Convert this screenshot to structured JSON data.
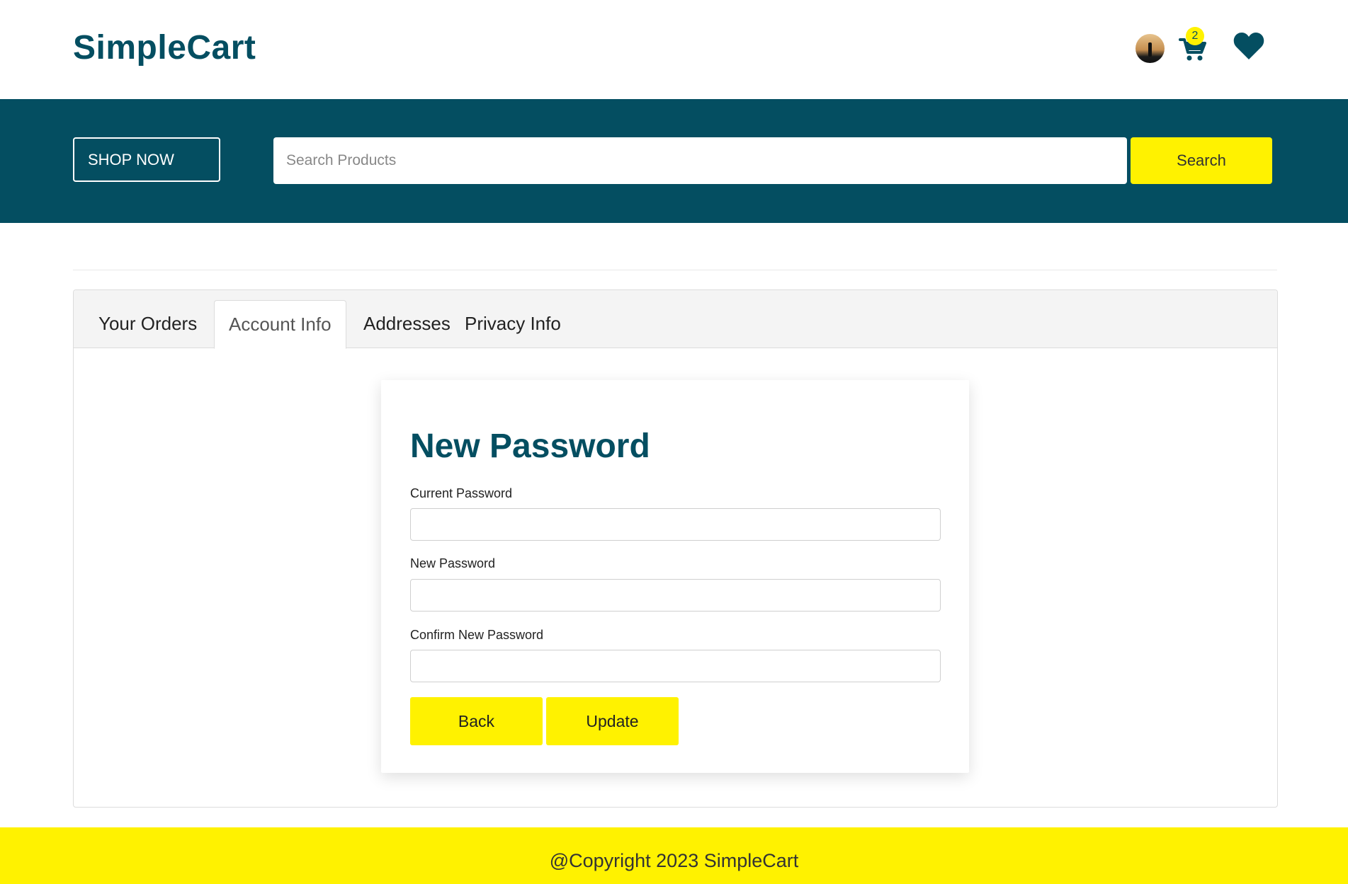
{
  "header": {
    "logo": "SimpleCart",
    "cart_count": "2"
  },
  "nav": {
    "shop_now_label": "SHOP NOW",
    "search_placeholder": "Search Products",
    "search_button_label": "Search"
  },
  "tabs": [
    {
      "label": "Your Orders",
      "active": false
    },
    {
      "label": "Account Info",
      "active": true
    },
    {
      "label": "Addresses",
      "active": false
    },
    {
      "label": "Privacy Info",
      "active": false
    }
  ],
  "form": {
    "title": "New Password",
    "fields": [
      {
        "label": "Current Password",
        "value": ""
      },
      {
        "label": "New Password",
        "value": ""
      },
      {
        "label": "Confirm New Password",
        "value": ""
      }
    ],
    "back_label": "Back",
    "update_label": "Update"
  },
  "footer": {
    "text": "@Copyright 2023 SimpleCart"
  },
  "colors": {
    "brand": "#044e61",
    "accent": "#fff200"
  },
  "icons": [
    "avatar",
    "cart-icon",
    "heart-icon"
  ]
}
